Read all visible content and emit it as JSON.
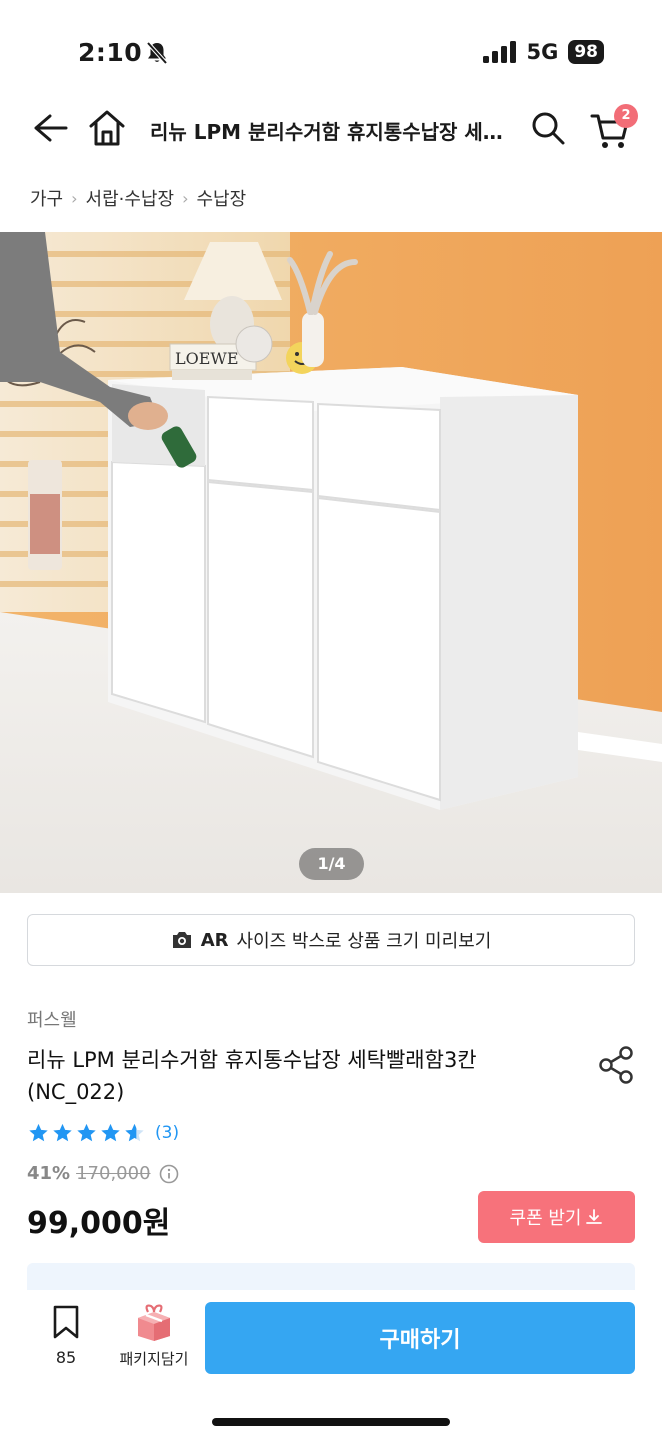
{
  "status": {
    "time": "2:10",
    "network": "5G",
    "battery": "98"
  },
  "nav": {
    "title": "리뉴 LPM 분리수거함 휴지통수납장 세탁빨래함3칸",
    "cart_count": "2"
  },
  "breadcrumb": [
    "가구",
    "서랍·수납장",
    "수납장"
  ],
  "gallery": {
    "page_indicator": "1/4",
    "current_page": 1,
    "total_pages": 4,
    "scene_text": "LOEWE"
  },
  "ar_button": {
    "prefix": "AR",
    "label": "사이즈 박스로 상품 크기 미리보기"
  },
  "product": {
    "seller": "퍼스웰",
    "name": "리뉴 LPM 분리수거함 휴지통수납장 세탁빨래함3칸 (NC_022)",
    "rating": 4.5,
    "review_count": "(3)",
    "discount_rate": "41%",
    "original_price": "170,000",
    "sale_price": "99,000원"
  },
  "coupon": {
    "label": "쿠폰 받기"
  },
  "bottom_bar": {
    "bookmark_count": "85",
    "package_label": "패키지담기",
    "buy_label": "구매하기"
  },
  "colors": {
    "accent_blue": "#35a6f2",
    "coupon_pink": "#f7727b",
    "star_blue": "#2196f3",
    "badge_pink": "#f26d77"
  },
  "icons": [
    "bell-muted-icon",
    "signal-icon",
    "back-arrow-icon",
    "home-icon",
    "search-icon",
    "cart-icon",
    "camera-icon",
    "share-icon",
    "star-icon",
    "info-icon",
    "download-icon",
    "bookmark-icon",
    "gift-box-icon"
  ]
}
